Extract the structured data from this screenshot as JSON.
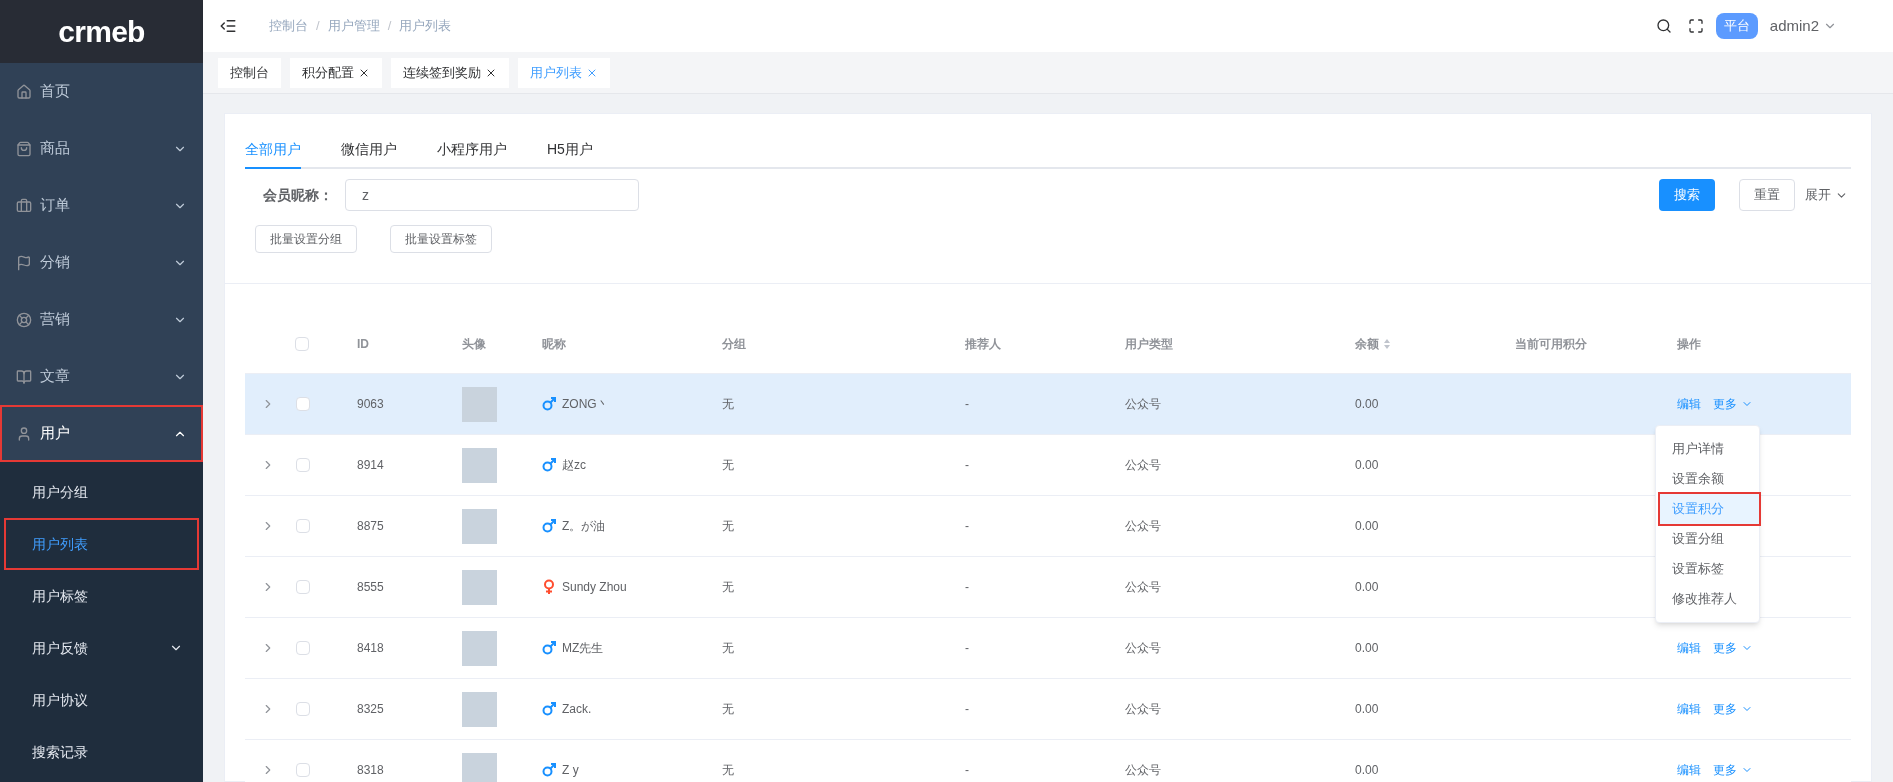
{
  "logo": "crmeb",
  "sidebar": {
    "items": [
      {
        "label": "首页",
        "expanded": false,
        "annotated": false
      },
      {
        "label": "商品",
        "expanded": false,
        "has_children": true,
        "annotated": false
      },
      {
        "label": "订单",
        "expanded": false,
        "has_children": true,
        "annotated": false
      },
      {
        "label": "分销",
        "expanded": false,
        "has_children": true,
        "annotated": false
      },
      {
        "label": "营销",
        "expanded": false,
        "has_children": true,
        "annotated": false
      },
      {
        "label": "文章",
        "expanded": false,
        "has_children": true,
        "annotated": false
      },
      {
        "label": "用户",
        "expanded": true,
        "has_children": true,
        "annotated": true,
        "children": [
          {
            "label": "用户分组",
            "selected": false,
            "annotated": false
          },
          {
            "label": "用户列表",
            "selected": true,
            "annotated": true
          },
          {
            "label": "用户标签",
            "selected": false,
            "annotated": false
          },
          {
            "label": "用户反馈",
            "selected": false,
            "annotated": false,
            "has_children": true
          },
          {
            "label": "用户协议",
            "selected": false,
            "annotated": false
          },
          {
            "label": "搜索记录",
            "selected": false,
            "annotated": false
          }
        ]
      }
    ]
  },
  "breadcrumb": {
    "separator": "/",
    "items": [
      "控制台",
      "用户管理",
      "用户列表"
    ]
  },
  "header": {
    "badge": "平台",
    "user": "admin2"
  },
  "tags": [
    {
      "label": "控制台",
      "closable": false,
      "selected": false
    },
    {
      "label": "积分配置",
      "closable": true,
      "selected": false
    },
    {
      "label": "连续签到奖励",
      "closable": true,
      "selected": false
    },
    {
      "label": "用户列表",
      "closable": true,
      "selected": true
    }
  ],
  "tabs": [
    {
      "label": "全部用户",
      "selected": true
    },
    {
      "label": "微信用户",
      "selected": false
    },
    {
      "label": "小程序用户",
      "selected": false
    },
    {
      "label": "H5用户",
      "selected": false
    }
  ],
  "filter": {
    "label": "会员昵称：",
    "value": "z",
    "search": "搜索",
    "reset": "重置",
    "expand": "展开"
  },
  "batch_buttons": [
    "批量设置分组",
    "批量设置标签"
  ],
  "table": {
    "select_all_checked": false,
    "columns": [
      "ID",
      "头像",
      "昵称",
      "分组",
      "推荐人",
      "用户类型",
      "余额",
      "当前可用积分",
      "操作"
    ],
    "rows": [
      {
        "id": "9063",
        "gender": {
          "kind": "male",
          "color": "#1890ff"
        },
        "nickname": "ZONG丶",
        "group": "无",
        "referrer": "-",
        "type": "公众号",
        "balance": "0.00",
        "checked": false,
        "hovered": true,
        "actions": [
          "编辑",
          "更多"
        ]
      },
      {
        "id": "8914",
        "gender": {
          "kind": "male",
          "color": "#1890ff"
        },
        "nickname": "赵zc",
        "group": "无",
        "referrer": "-",
        "type": "公众号",
        "balance": "0.00",
        "checked": false,
        "hovered": false
      },
      {
        "id": "8875",
        "gender": {
          "kind": "male",
          "color": "#1890ff"
        },
        "nickname": "Z。が油",
        "group": "无",
        "referrer": "-",
        "type": "公众号",
        "balance": "0.00",
        "checked": false,
        "hovered": false
      },
      {
        "id": "8555",
        "gender": {
          "kind": "female",
          "color": "#ff4d2e"
        },
        "nickname": "Sundy Zhou",
        "group": "无",
        "referrer": "-",
        "type": "公众号",
        "balance": "0.00",
        "checked": false,
        "hovered": false
      },
      {
        "id": "8418",
        "gender": {
          "kind": "male",
          "color": "#1890ff"
        },
        "nickname": "MZ先生",
        "group": "无",
        "referrer": "-",
        "type": "公众号",
        "balance": "0.00",
        "checked": false,
        "hovered": false,
        "actions": [
          "编辑",
          "更多"
        ]
      },
      {
        "id": "8325",
        "gender": {
          "kind": "male",
          "color": "#1890ff"
        },
        "nickname": "Zack.",
        "group": "无",
        "referrer": "-",
        "type": "公众号",
        "balance": "0.00",
        "checked": false,
        "hovered": false,
        "actions": [
          "编辑",
          "更多"
        ]
      },
      {
        "id": "8318",
        "gender": {
          "kind": "male",
          "color": "#1890ff"
        },
        "nickname": "Z y",
        "group": "无",
        "referrer": "-",
        "type": "公众号",
        "balance": "0.00",
        "checked": false,
        "hovered": false,
        "actions": [
          "编辑",
          "更多"
        ]
      }
    ]
  },
  "more_menu": [
    {
      "label": "用户详情",
      "selected": false
    },
    {
      "label": "设置余额",
      "selected": false
    },
    {
      "label": "设置积分",
      "selected": true
    },
    {
      "label": "设置分组",
      "selected": false
    },
    {
      "label": "设置标签",
      "selected": false
    },
    {
      "label": "修改推荐人",
      "selected": false
    }
  ]
}
